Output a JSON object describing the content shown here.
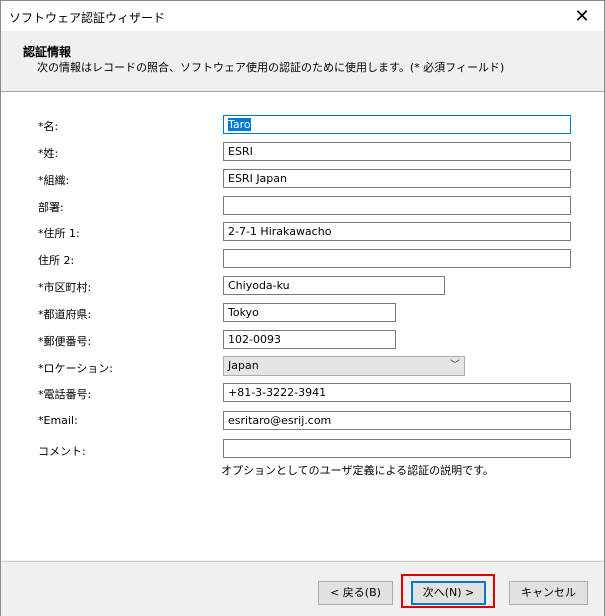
{
  "window": {
    "title": "ソフトウェア認証ウィザード",
    "close_glyph": "✕"
  },
  "header": {
    "title": "認証情報",
    "description": "次の情報はレコードの照合、ソフトウェア使用の認証のために使用します。(* 必須フィールド)"
  },
  "form": {
    "first_name": {
      "label": "*名:",
      "value": "Taro"
    },
    "last_name": {
      "label": "*姓:",
      "value": "ESRI"
    },
    "organization": {
      "label": "*組織:",
      "value": "ESRI Japan"
    },
    "department": {
      "label": "部署:",
      "value": ""
    },
    "address1": {
      "label": "*住所 1:",
      "value": "2-7-1 Hirakawacho"
    },
    "address2": {
      "label": "住所 2:",
      "value": ""
    },
    "city": {
      "label": "*市区町村:",
      "value": "Chiyoda-ku"
    },
    "prefecture": {
      "label": "*都道府県:",
      "value": "Tokyo"
    },
    "postal_code": {
      "label": "*郵便番号:",
      "value": "102-0093"
    },
    "location": {
      "label": "*ロケーション:",
      "value": "Japan"
    },
    "phone": {
      "label": "*電話番号:",
      "value": "+81-3-3222-3941"
    },
    "email": {
      "label": "*Email:",
      "value": "esritaro@esrij.com"
    },
    "comment": {
      "label": "コメント:",
      "value": "",
      "hint": "オプションとしてのユーザ定義による認証の説明です。"
    }
  },
  "buttons": {
    "back": "< 戻る(B)",
    "next": "次へ(N) >",
    "cancel": "キャンセル"
  },
  "colors": {
    "accent": "#0078d7",
    "highlight": "#e00000"
  }
}
